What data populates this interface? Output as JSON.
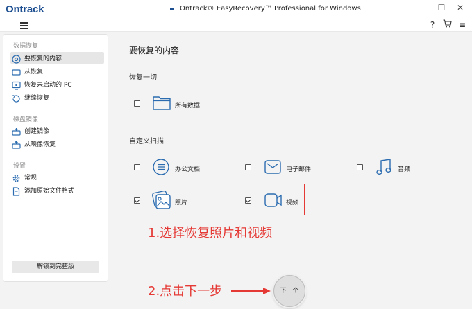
{
  "titlebar": {
    "logo": "Ontrack",
    "title": "Ontrack® EasyRecovery™ Professional for Windows",
    "minimize": "—",
    "maximize": "☐",
    "close": "✕"
  },
  "toolbar": {
    "help": "?",
    "cart": "🛒",
    "menu": "≡"
  },
  "sidebar": {
    "sections": [
      {
        "label": "数据恢复",
        "items": [
          {
            "label": "要恢复的内容",
            "icon": "search-disk-icon",
            "active": true
          },
          {
            "label": "从恢复",
            "icon": "drive-icon",
            "active": false
          },
          {
            "label": "恢复未启动的 PC",
            "icon": "monitor-icon",
            "active": false
          },
          {
            "label": "继续恢复",
            "icon": "resume-icon",
            "active": false
          }
        ]
      },
      {
        "label": "磁盘镜像",
        "items": [
          {
            "label": "创建镜像",
            "icon": "create-image-icon",
            "active": false
          },
          {
            "label": "从映像恢复",
            "icon": "restore-image-icon",
            "active": false
          }
        ]
      },
      {
        "label": "设置",
        "items": [
          {
            "label": "常规",
            "icon": "gear-icon",
            "active": false
          },
          {
            "label": "添加原始文件格式",
            "icon": "add-file-icon",
            "active": false
          }
        ]
      }
    ],
    "unlock_label": "解锁到完整版"
  },
  "main": {
    "title": "要恢复的内容",
    "recover_all": {
      "title": "恢复一切",
      "option": {
        "label": "所有数据",
        "icon": "folder-icon",
        "checked": false
      }
    },
    "custom_scan": {
      "title": "自定义扫描",
      "options": [
        {
          "label": "办公文档",
          "icon": "document-icon",
          "checked": false
        },
        {
          "label": "电子邮件",
          "icon": "email-icon",
          "checked": false
        },
        {
          "label": "音频",
          "icon": "music-icon",
          "checked": false
        },
        {
          "label": "照片",
          "icon": "photo-icon",
          "checked": true
        },
        {
          "label": "视频",
          "icon": "video-icon",
          "checked": true
        }
      ]
    },
    "next_label": "下一个"
  },
  "annotations": {
    "step1": "1.选择恢复照片和视频",
    "step2": "2.点击下一步"
  },
  "colors": {
    "brand": "#1d4f91",
    "accent": "#2b6cb0",
    "annotation": "#e53935"
  }
}
